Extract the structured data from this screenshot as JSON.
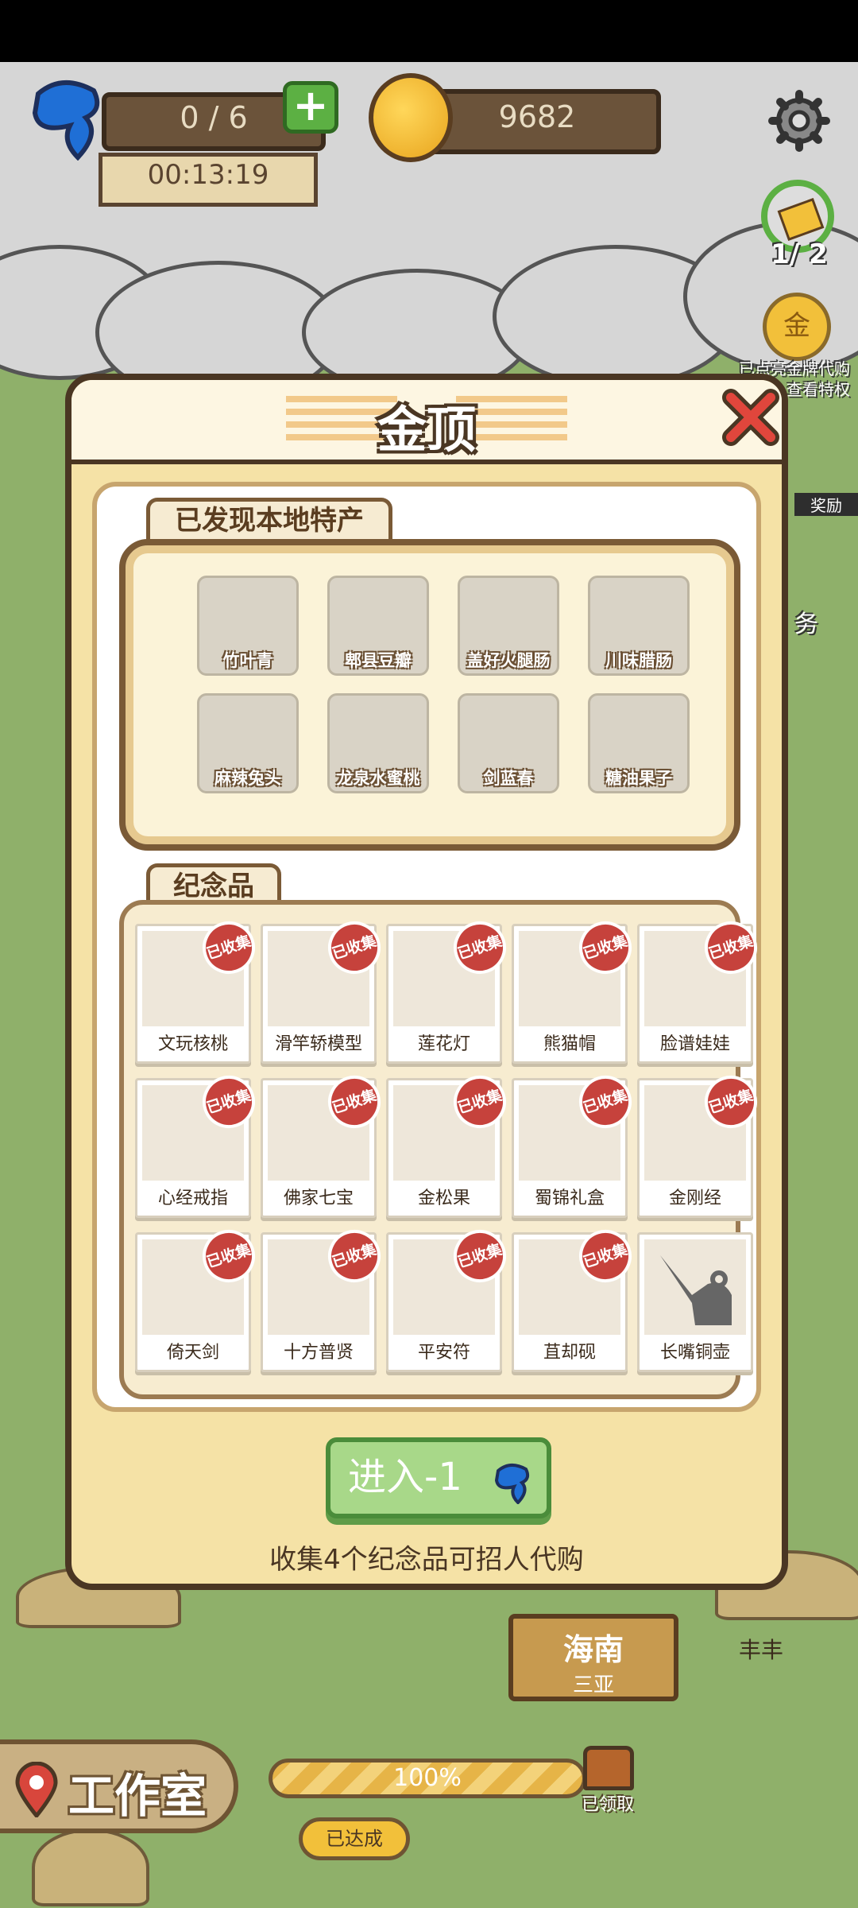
{
  "hud": {
    "energy": "0 / 6",
    "timer": "00:13:19",
    "coins": "9682",
    "ticket_count": "1/ 2",
    "gold_badge_label": "金",
    "gold_banner": "已点亮金牌代购",
    "gold_banner_sub": "查看特权",
    "reward_tag": "奖励",
    "task_tag": "务"
  },
  "dialog": {
    "title": "金顶",
    "specialty_section_label": "已发现本地特产",
    "specialties": [
      "竹叶青",
      "郫县豆瓣",
      "盖好火腿肠",
      "川味腊肠",
      "麻辣兔头",
      "龙泉水蜜桃",
      "剑蓝春",
      "糖油果子"
    ],
    "souvenir_section_label": "纪念品",
    "collected_stamp": "已收集",
    "souvenirs": [
      {
        "label": "文玩核桃",
        "collected": true
      },
      {
        "label": "滑竿轿模型",
        "collected": true
      },
      {
        "label": "莲花灯",
        "collected": true
      },
      {
        "label": "熊猫帽",
        "collected": true
      },
      {
        "label": "脸谱娃娃",
        "collected": true
      },
      {
        "label": "心经戒指",
        "collected": true
      },
      {
        "label": "佛家七宝",
        "collected": true
      },
      {
        "label": "金松果",
        "collected": true
      },
      {
        "label": "蜀锦礼盒",
        "collected": true
      },
      {
        "label": "金刚经",
        "collected": true
      },
      {
        "label": "倚天剑",
        "collected": true
      },
      {
        "label": "十方普贤",
        "collected": true
      },
      {
        "label": "平安符",
        "collected": true
      },
      {
        "label": "苴却砚",
        "collected": true
      },
      {
        "label": "长嘴铜壶",
        "collected": false
      }
    ],
    "enter_button": "进入-1",
    "hint": "收集4个纪念品可招人代购"
  },
  "map": {
    "sign_title": "海南",
    "sign_sub": "三亚",
    "studio_button": "工作室",
    "progress_text": "100%",
    "achieved_label": "已达成",
    "claimed_label": "已领取",
    "place_label": "丰丰"
  },
  "colors": {
    "accent_green": "#a8d889",
    "stamp_red": "#c6423c",
    "frame_brown": "#4a3623"
  }
}
